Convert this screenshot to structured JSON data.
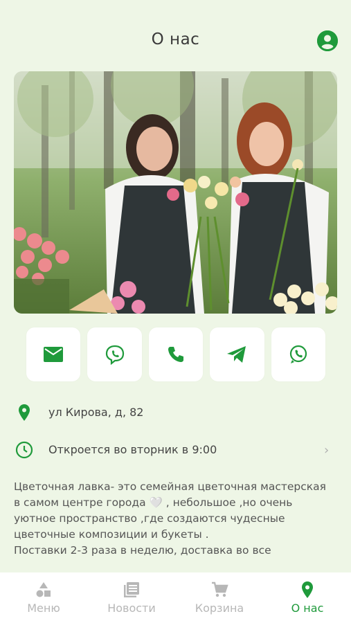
{
  "header": {
    "title": "О нас",
    "profile_icon": "account-circle-icon"
  },
  "hero": {
    "image": "two-florists-with-bouquets-photo"
  },
  "contacts": [
    {
      "name": "email",
      "icon": "mail-icon"
    },
    {
      "name": "viber",
      "icon": "viber-icon"
    },
    {
      "name": "phone",
      "icon": "phone-icon"
    },
    {
      "name": "telegram",
      "icon": "telegram-icon"
    },
    {
      "name": "whatsapp",
      "icon": "whatsapp-icon"
    }
  ],
  "info": {
    "address": "ул Кирова, д, 82",
    "hours": "Откроется во вторник в 9:00"
  },
  "description": {
    "text1": "Цветочная лавка- это семейная цветочная мастерская в самом центре города 🤍 , небольшое ,но очень уютное пространство ,где создаются чудесные цветочные композиции и букеты .",
    "text2": "Поставки 2-3 раза в неделю, доставка во все"
  },
  "tabbar": {
    "tabs": [
      {
        "label": "Меню"
      },
      {
        "label": "Новости"
      },
      {
        "label": "Корзина"
      },
      {
        "label": "О нас"
      }
    ]
  },
  "colors": {
    "accent": "#1f9a3b",
    "background": "#eef6e6",
    "inactive": "#b7b7b7"
  }
}
